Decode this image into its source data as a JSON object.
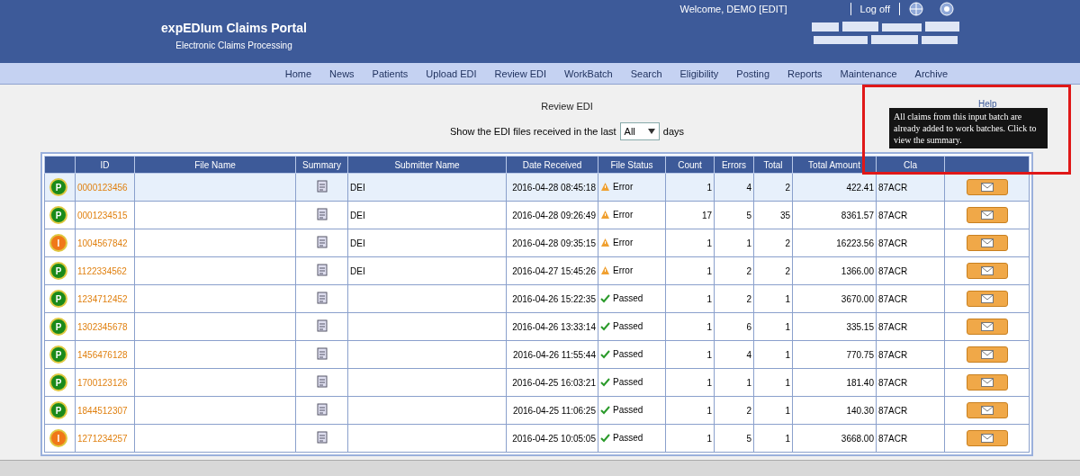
{
  "header": {
    "title": "expEDIum Claims Portal",
    "subtitle": "Electronic Claims Processing",
    "welcome": "Welcome, DEMO [EDIT]",
    "logoff": "Log off"
  },
  "nav": [
    "Home",
    "News",
    "Patients",
    "Upload EDI",
    "Review EDI",
    "WorkBatch",
    "Search",
    "Eligibility",
    "Posting",
    "Reports",
    "Maintenance",
    "Archive"
  ],
  "page": {
    "title": "Review EDI",
    "filter_before": "Show the EDI files received in the last",
    "filter_value": "All",
    "filter_after": "days"
  },
  "table": {
    "columns": [
      "",
      "ID",
      "File Name",
      "Summary",
      "Submitter Name",
      "Date Received",
      "File Status",
      "Count",
      "Errors",
      "Total",
      "Total Amount",
      "Cla",
      ""
    ],
    "rows": [
      {
        "badge": "P",
        "color": "#1a8a1a",
        "id": "0000123456",
        "submitter": "DEI",
        "date": "2016-04-28 08:45:18",
        "kind": "error",
        "status": "Error",
        "count": "1",
        "errors": "4",
        "total": "2",
        "amount": "422.41",
        "code": "87ACR",
        "selected": true
      },
      {
        "badge": "P",
        "color": "#1a8a1a",
        "id": "0001234515",
        "submitter": "DEI",
        "date": "2016-04-28 09:26:49",
        "kind": "error",
        "status": "Error",
        "count": "17",
        "errors": "5",
        "total": "35",
        "amount": "8361.57",
        "code": "87ACR",
        "selected": false
      },
      {
        "badge": "I",
        "color": "#f07818",
        "id": "1004567842",
        "submitter": "DEI",
        "date": "2016-04-28 09:35:15",
        "kind": "error",
        "status": "Error",
        "count": "1",
        "errors": "1",
        "total": "2",
        "amount": "16223.56",
        "code": "87ACR",
        "selected": false
      },
      {
        "badge": "P",
        "color": "#1a8a1a",
        "id": "1122334562",
        "submitter": "DEI",
        "date": "2016-04-27 15:45:26",
        "kind": "error",
        "status": "Error",
        "count": "1",
        "errors": "2",
        "total": "2",
        "amount": "1366.00",
        "code": "87ACR",
        "selected": false
      },
      {
        "badge": "P",
        "color": "#1a8a1a",
        "id": "1234712452",
        "submitter": "",
        "date": "2016-04-26 15:22:35",
        "kind": "passed",
        "status": "Passed",
        "count": "1",
        "errors": "2",
        "total": "1",
        "amount": "3670.00",
        "code": "87ACR",
        "selected": false
      },
      {
        "badge": "P",
        "color": "#1a8a1a",
        "id": "1302345678",
        "submitter": "",
        "date": "2016-04-26 13:33:14",
        "kind": "passed",
        "status": "Passed",
        "count": "1",
        "errors": "6",
        "total": "1",
        "amount": "335.15",
        "code": "87ACR",
        "selected": false
      },
      {
        "badge": "P",
        "color": "#1a8a1a",
        "id": "1456476128",
        "submitter": "",
        "date": "2016-04-26 11:55:44",
        "kind": "passed",
        "status": "Passed",
        "count": "1",
        "errors": "4",
        "total": "1",
        "amount": "770.75",
        "code": "87ACR",
        "selected": false
      },
      {
        "badge": "P",
        "color": "#1a8a1a",
        "id": "1700123126",
        "submitter": "",
        "date": "2016-04-25 16:03:21",
        "kind": "passed",
        "status": "Passed",
        "count": "1",
        "errors": "1",
        "total": "1",
        "amount": "181.40",
        "code": "87ACR",
        "selected": false
      },
      {
        "badge": "P",
        "color": "#1a8a1a",
        "id": "1844512307",
        "submitter": "",
        "date": "2016-04-25 11:06:25",
        "kind": "passed",
        "status": "Passed",
        "count": "1",
        "errors": "2",
        "total": "1",
        "amount": "140.30",
        "code": "87ACR",
        "selected": false
      },
      {
        "badge": "I",
        "color": "#f07818",
        "id": "1271234257",
        "submitter": "",
        "date": "2016-04-25 10:05:05",
        "kind": "passed",
        "status": "Passed",
        "count": "1",
        "errors": "5",
        "total": "1",
        "amount": "3668.00",
        "code": "87ACR",
        "selected": false
      }
    ]
  },
  "tooltip": {
    "label": "Help",
    "text": "All claims from this input batch are already added to work batches. Click to view the summary."
  }
}
